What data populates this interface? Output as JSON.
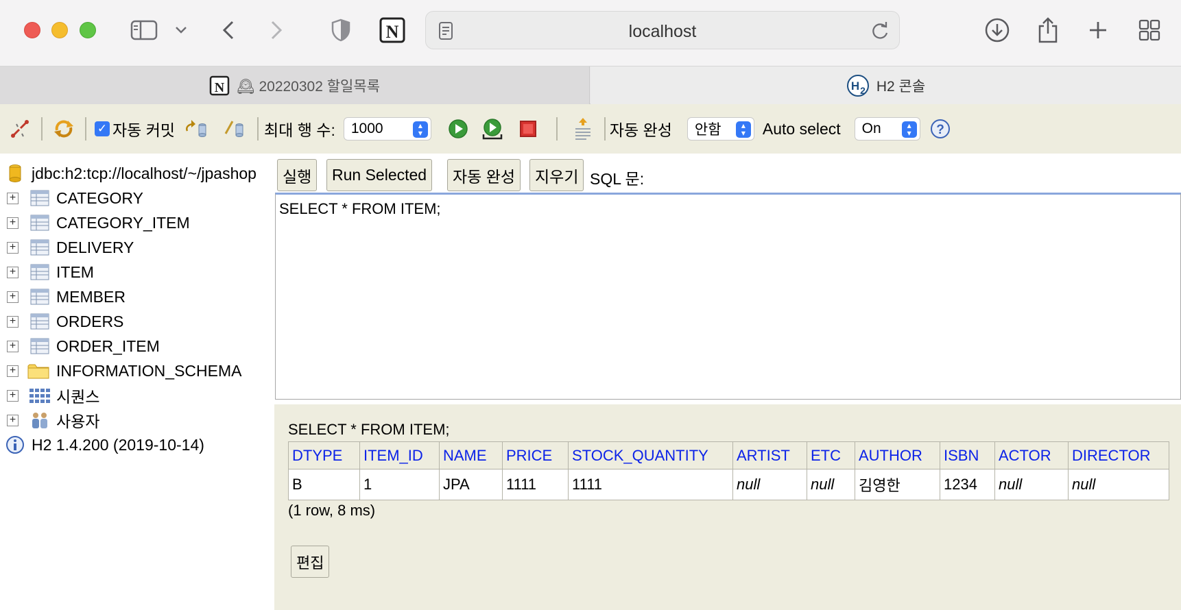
{
  "browser": {
    "url": "localhost",
    "tabs": [
      {
        "label": "🕰 20220302 할일목록",
        "active": false
      },
      {
        "label": "H2 콘솔",
        "active": true
      }
    ]
  },
  "toolbar": {
    "auto_commit_label": "자동 커밋",
    "auto_commit_checked": true,
    "max_rows_label": "최대 행 수:",
    "max_rows_value": "1000",
    "autocomplete_label": "자동 완성",
    "autocomplete_value": "안함",
    "auto_select_label": "Auto select",
    "auto_select_value": "On"
  },
  "tree": {
    "connection": "jdbc:h2:tcp://localhost/~/jpashop",
    "tables": [
      "CATEGORY",
      "CATEGORY_ITEM",
      "DELIVERY",
      "ITEM",
      "MEMBER",
      "ORDERS",
      "ORDER_ITEM"
    ],
    "schema": "INFORMATION_SCHEMA",
    "sequences": "시퀀스",
    "users": "사용자",
    "version": "H2 1.4.200 (2019-10-14)"
  },
  "query": {
    "run_label": "실행",
    "run_selected_label": "Run Selected",
    "autocomplete_label": "자동 완성",
    "clear_label": "지우기",
    "sql_label": "SQL 문:",
    "sql_text": "SELECT * FROM ITEM;"
  },
  "results": {
    "sql": "SELECT * FROM ITEM;",
    "columns": [
      "DTYPE",
      "ITEM_ID",
      "NAME",
      "PRICE",
      "STOCK_QUANTITY",
      "ARTIST",
      "ETC",
      "AUTHOR",
      "ISBN",
      "ACTOR",
      "DIRECTOR"
    ],
    "rows": [
      [
        "B",
        "1",
        "JPA",
        "1111",
        "1111",
        "null",
        "null",
        "김영한",
        "1234",
        "null",
        "null"
      ]
    ],
    "info": "(1 row, 8 ms)",
    "edit_label": "편집"
  },
  "colors": {
    "accent": "#3478f6",
    "header_link": "#0b22e8",
    "panel_bg": "#eeeddf"
  }
}
